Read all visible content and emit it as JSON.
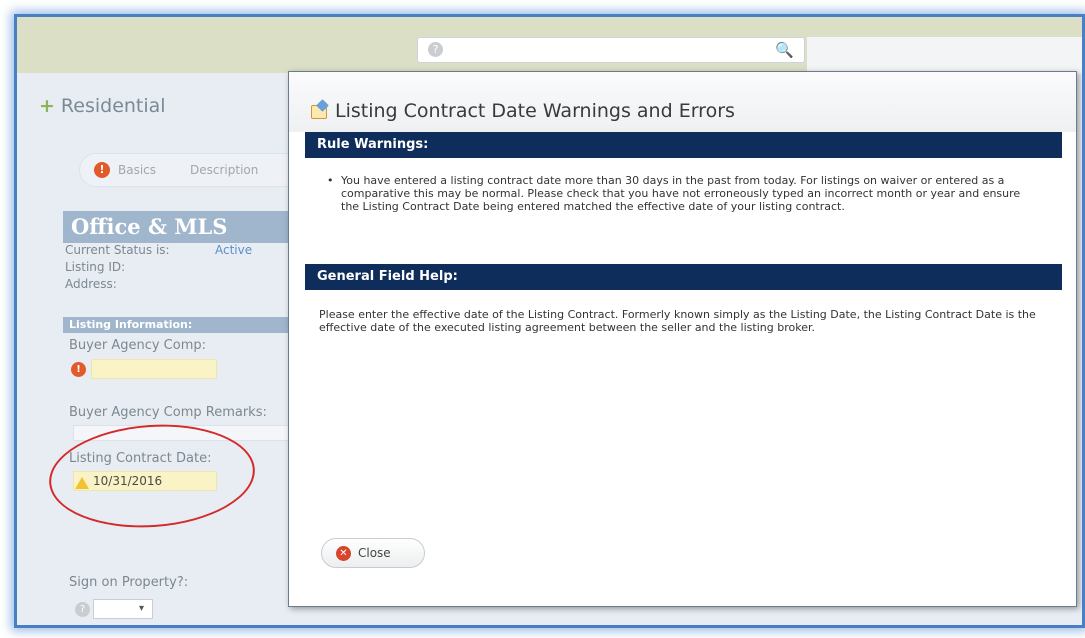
{
  "search": {
    "help_glyph": "?",
    "search_glyph": "🔍"
  },
  "form": {
    "title": "Residential",
    "tabs": [
      "Basics",
      "Description"
    ],
    "section_title": "Office & MLS",
    "current_status_label": "Current Status is:",
    "current_status_value": "Active",
    "listing_id_label": "Listing ID:",
    "address_label": "Address:",
    "listing_info_title": "Listing Information:",
    "buyer_agency_comp_label": "Buyer Agency Comp:",
    "buyer_agency_remarks_label": "Buyer Agency Comp Remarks:",
    "listing_contract_date_label": "Listing Contract Date:",
    "listing_contract_date_value": "10/31/2016",
    "sign_on_property_label": "Sign on Property?:",
    "sign_on_property_value": "▾"
  },
  "modal": {
    "title": "Listing Contract Date Warnings and Errors",
    "rule_warnings_header": "Rule Warnings:",
    "rule_warning_text": "You have entered a listing contract date more than 30 days in the past from today. For listings on waiver or entered as a comparative this may be normal. Please check that you have not erroneously typed an incorrect month or year and ensure the Listing Contract Date being entered matched the effective date of your listing contract.",
    "general_help_header": "General Field Help:",
    "general_help_text": "Please enter the effective date of the Listing Contract. Formerly known simply as the Listing Date, the Listing Contract Date is the effective date of the executed listing agreement between the seller and the listing broker.",
    "close_label": "Close"
  },
  "colors": {
    "section_bar": "#0e2d5b",
    "error": "#e25a2a",
    "annotation_circle": "#d42a2a",
    "warning": "#f2c230"
  }
}
